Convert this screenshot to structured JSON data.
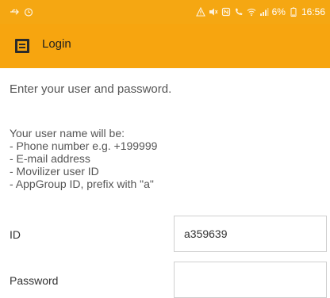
{
  "status_bar": {
    "battery_text": "6%",
    "time": "16:56"
  },
  "app_bar": {
    "title": "Login"
  },
  "form": {
    "intro": "Enter your user and password.",
    "rules": [
      "Your user name will be:",
      "- Phone number e.g. +199999",
      "- E-mail address",
      "- Movilizer user ID",
      "- AppGroup ID, prefix with \"a\""
    ],
    "id_label": "ID",
    "id_value": "a359639",
    "password_label": "Password",
    "password_value": ""
  }
}
